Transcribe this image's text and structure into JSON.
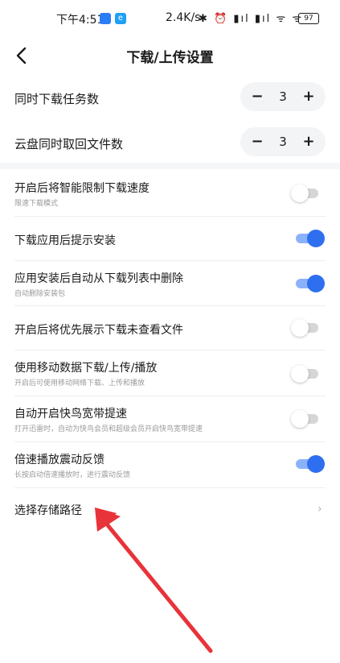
{
  "status_bar": {
    "time": "下午4:51",
    "net_speed": "2.4K/s",
    "icons_text": "✱ ⏰ ▮ıl ▮ıl ᯤ ᯤ",
    "battery": "97"
  },
  "nav": {
    "title": "下载/上传设置"
  },
  "steppers": [
    {
      "label": "同时下载任务数",
      "value": "3",
      "minus": "−",
      "plus": "+"
    },
    {
      "label": "云盘同时取回文件数",
      "value": "3",
      "minus": "−",
      "plus": "+"
    }
  ],
  "toggles": [
    {
      "title": "开启后将智能限制下载速度",
      "subtitle": "限速下载模式",
      "on": false
    },
    {
      "title": "下载应用后提示安装",
      "subtitle": "",
      "on": true
    },
    {
      "title": "应用安装后自动从下载列表中删除",
      "subtitle": "自动删除安装包",
      "on": true
    },
    {
      "title": "开启后将优先展示下载未查看文件",
      "subtitle": "",
      "on": false
    },
    {
      "title": "使用移动数据下载/上传/播放",
      "subtitle": "开启后可使用移动网络下载、上传和播放",
      "on": false
    },
    {
      "title": "自动开启快鸟宽带提速",
      "subtitle": "打开迅雷时，自动为快鸟会员和超级会员开启快鸟宽带提速",
      "on": false
    },
    {
      "title": "倍速播放震动反馈",
      "subtitle": "长按启动倍速播放时，进行震动反馈",
      "on": true
    }
  ],
  "storage": {
    "label": "选择存储路径",
    "chevron": "›"
  },
  "colors": {
    "accent": "#2e6ff0",
    "annotation_arrow": "#e8333a"
  }
}
